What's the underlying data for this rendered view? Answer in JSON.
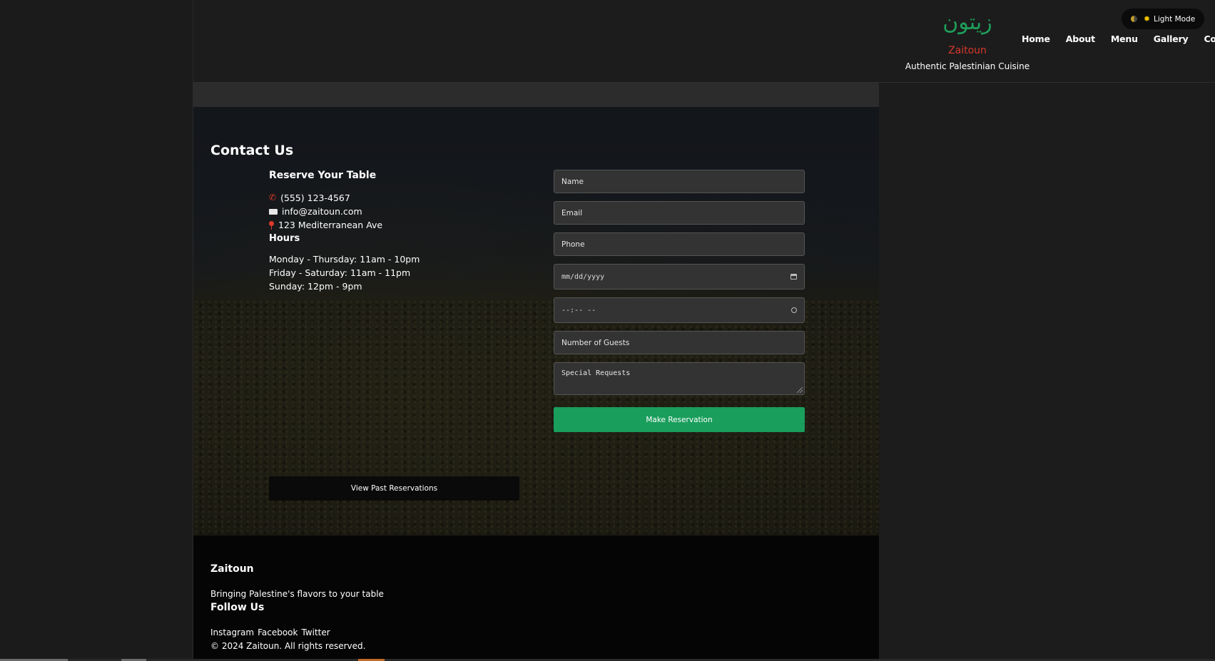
{
  "brand": {
    "arabic": "زيتون",
    "latin": "Zaitoun",
    "tagline": "Authentic Palestinian Cuisine"
  },
  "nav": {
    "items": [
      "Home",
      "About",
      "Menu",
      "Gallery",
      "Contact"
    ]
  },
  "mode_toggle": {
    "label": "Light Mode",
    "icon_left": "half-moon-icon",
    "icon_right": "sun-icon"
  },
  "contact": {
    "title": "Contact Us",
    "reserve_heading": "Reserve Your Table",
    "phone": "(555) 123-4567",
    "email": "info@zaitoun.com",
    "address": "123 Mediterranean Ave",
    "hours_heading": "Hours",
    "hours": [
      "Monday - Thursday: 11am - 10pm",
      "Friday - Saturday: 11am - 11pm",
      "Sunday: 12pm - 9pm"
    ]
  },
  "form": {
    "name_placeholder": "Name",
    "email_placeholder": "Email",
    "phone_placeholder": "Phone",
    "date_placeholder": "mm/dd/yyyy",
    "time_placeholder": "--:-- --",
    "guests_placeholder": "Number of Guests",
    "requests_placeholder": "Special Requests",
    "submit_label": "Make Reservation"
  },
  "past_reservations": {
    "label": "View Past Reservations"
  },
  "footer": {
    "brand": "Zaitoun",
    "tagline": "Bringing Palestine's flavors to your table",
    "follow_heading": "Follow Us",
    "social": [
      "Instagram",
      "Facebook",
      "Twitter"
    ],
    "copyright": "© 2024 Zaitoun. All rights reserved."
  },
  "colors": {
    "accent_green": "#1a9e5c",
    "brand_red": "#d6382b",
    "background": "#1c1c1c",
    "footer_bg": "#050505"
  }
}
